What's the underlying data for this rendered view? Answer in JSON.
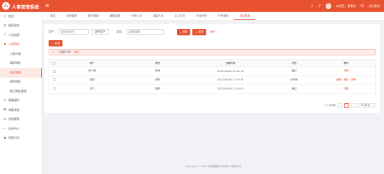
{
  "app": {
    "logo_char": "人",
    "title": "人事管理系统",
    "accent": "#e8522f"
  },
  "topbar": {
    "menu_icon": "hamburger-icon",
    "icons": [
      "search-icon",
      "bell-icon"
    ],
    "welcome": "欢迎您，管理员",
    "logout": "退出登录"
  },
  "sidebar": {
    "items": [
      {
        "icon": "home-icon",
        "label": "首页",
        "caret": ""
      },
      {
        "icon": "dept-icon",
        "label": "组织架构",
        "caret": "›"
      },
      {
        "icon": "staff-icon",
        "label": "人员档案",
        "caret": "›"
      },
      {
        "icon": "entry-icon",
        "label": "入职离职",
        "caret": "⌄"
      }
    ],
    "subitems": [
      {
        "label": "入职办理",
        "active": false
      },
      {
        "label": "离职审批",
        "active": false
      },
      {
        "label": "减员管理",
        "active": true
      },
      {
        "label": "调岗审批",
        "active": false
      },
      {
        "label": "转正审批管理",
        "active": false
      }
    ],
    "items2": [
      {
        "icon": "salary-icon",
        "label": "薪酬福利",
        "caret": "›"
      },
      {
        "icon": "attendance-icon",
        "label": "考勤休假",
        "caret": "›"
      },
      {
        "icon": "system-icon",
        "label": "系统管理",
        "caret": "›"
      },
      {
        "icon": "message-icon",
        "label": "消息中心",
        "caret": "›"
      },
      {
        "icon": "log-icon",
        "label": "系统日志",
        "caret": "›"
      }
    ]
  },
  "tabs": [
    {
      "label": "首页",
      "active": false
    },
    {
      "label": "机构管理",
      "active": false
    },
    {
      "label": "职位管理",
      "active": false
    },
    {
      "label": "编制管理",
      "active": false
    },
    {
      "label": "在职人员",
      "active": false
    },
    {
      "label": "离退人员",
      "active": false
    },
    {
      "label": "实习人员",
      "active": false
    },
    {
      "label": "干部任免",
      "active": false
    },
    {
      "label": "任免审批",
      "active": false
    },
    {
      "label": "减员管理",
      "active": true
    }
  ],
  "filter": {
    "user_label": "用户：",
    "user_placeholder": "请先选择用户",
    "user_btn": "选择用户",
    "type_label": "类型：",
    "type_placeholder": "请选择类型",
    "search_btn": "搜索",
    "reset_btn": "重置",
    "expand": "展开 ⌄"
  },
  "toolbar": {
    "add_btn": "新增"
  },
  "alert": {
    "text": "已选择 0项",
    "clear": "清空"
  },
  "table": {
    "headers": [
      "用户",
      "类型",
      "创建时间",
      "状态",
      "操作"
    ],
    "rows": [
      {
        "user": "萨小丽",
        "type": "离休",
        "time": "2022-06-09 14:02:15",
        "status": "通过",
        "ops": [
          "详情"
        ]
      },
      {
        "user": "张新",
        "type": "辞职",
        "time": "2022-06-08 17:29:41",
        "status": "待审核",
        "ops": [
          "编辑",
          "删除",
          "详情"
        ]
      },
      {
        "user": "张三",
        "type": "辞职",
        "time": "2022-06-08 11:43:01",
        "status": "通过",
        "ops": [
          "详情"
        ]
      }
    ]
  },
  "pager": {
    "total": "1-3 共3条",
    "prev": "‹",
    "current": "1",
    "next": "›",
    "size": "10 条/页"
  },
  "footer": "Copyright © 2022 河南数据电子有限公司版权所有"
}
